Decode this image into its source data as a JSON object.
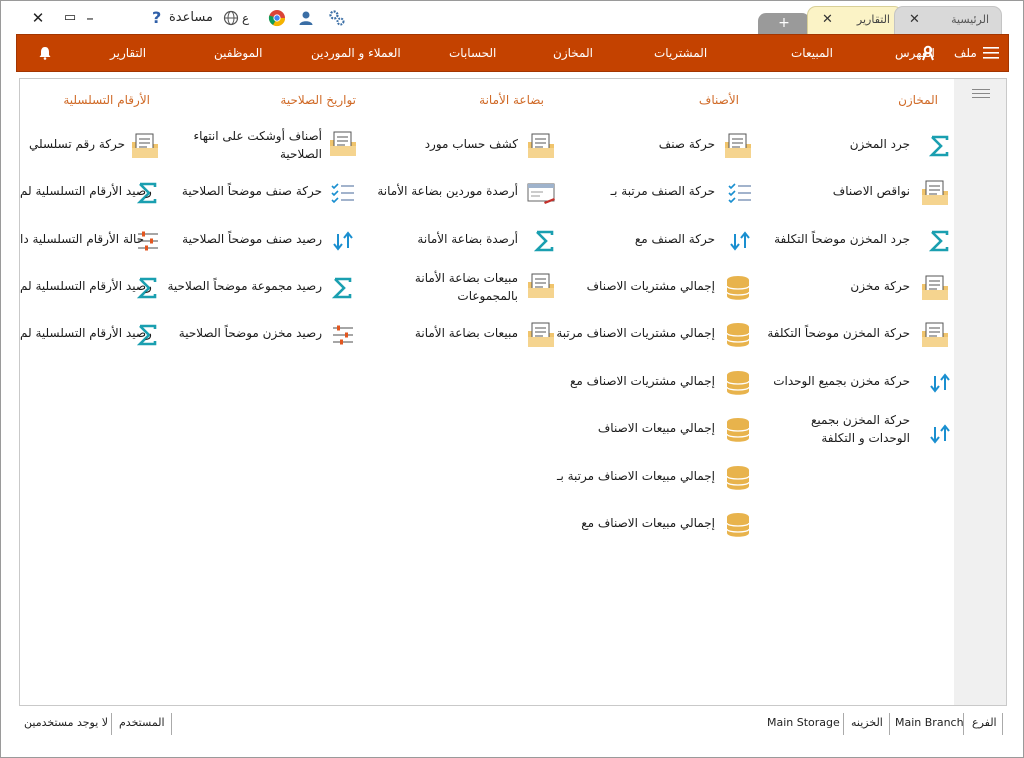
{
  "window": {
    "close": "✕",
    "maximize": "▭",
    "minimize": "–"
  },
  "toolbar": {
    "help_label": "مساعدة",
    "help_icon": "?",
    "lang_label": "ع"
  },
  "tabs": [
    {
      "label": "الرئيسية",
      "close": "✕"
    },
    {
      "label": "التقارير",
      "close": "✕"
    }
  ],
  "tab_add": "+",
  "menu": {
    "file": "ملف",
    "index": "الفهرس",
    "sales": "المبيعات",
    "purchases": "المشتريات",
    "stores": "المخازن",
    "accounts": "الحسابات",
    "customers_suppliers": "العملاء و الموردين",
    "employees": "الموظفين",
    "reports": "التقارير"
  },
  "columns": {
    "stores": {
      "header": "المخازن",
      "items": [
        "جرد المخزن",
        "نواقص الاصناف",
        "جرد المخزن موضحاً التكلفة",
        "حركة مخزن",
        "حركة المخزن موضحاً التكلفة",
        "حركة مخزن بجميع الوحدات",
        "حركة المخزن بجميع الوحدات و التكلفة"
      ]
    },
    "items": {
      "header": "الأصناف",
      "items": [
        "حركة صنف",
        "حركة الصنف مرتبة بـ",
        "حركة الصنف مع",
        "إجمالي مشتريات الاصناف",
        "إجمالي مشتريات الاصناف مرتبة بـ",
        "إجمالي مشتريات الاصناف مع",
        "إجمالي مبيعات الاصناف",
        "إجمالي مبيعات الاصناف مرتبة بـ",
        "إجمالي مبيعات الاصناف مع"
      ]
    },
    "consignment": {
      "header": "بضاعة الأمانة",
      "items": [
        "كشف حساب مورد",
        "أرصدة موردين بضاعة الأمانة",
        "أرصدة بضاعة الأمانة",
        "مبيعات بضاعة الأمانة بالمجموعات",
        "مبيعات بضاعة الأمانة"
      ]
    },
    "expiry": {
      "header": "تواريخ الصلاحية",
      "items": [
        "أصناف أوشكت على انتهاء الصلاحية",
        "حركة صنف موضحاً الصلاحية",
        "رصيد صنف موضحاً الصلاحية",
        "رصيد مجموعة موضحاً الصلاحية",
        "رصيد مخزن موضحاً الصلاحية"
      ]
    },
    "serials": {
      "header": "الأرقام التسلسلية",
      "items": [
        "حركة رقم تسلسلي",
        "رصيد الأرقام التسلسلية لم",
        "حالة الأرقام التسلسلية دا",
        "رصيد الأرقام التسلسلية لم",
        "رصيد الأرقام التسلسلية لم"
      ]
    }
  },
  "status": {
    "branch_label": "الفرع",
    "branch_value": "Main Branch",
    "treasury_label": "الخزينه",
    "storage_value": "Main Storage",
    "user_label": "المستخدم",
    "user_value": "لا يوجد مستخدمين"
  },
  "colors": {
    "menu_bg": "#c44200",
    "header_text": "#d06a27",
    "sigma": "#1a9fb0",
    "folder": "#f0c46c",
    "database": "#e8b34c"
  }
}
